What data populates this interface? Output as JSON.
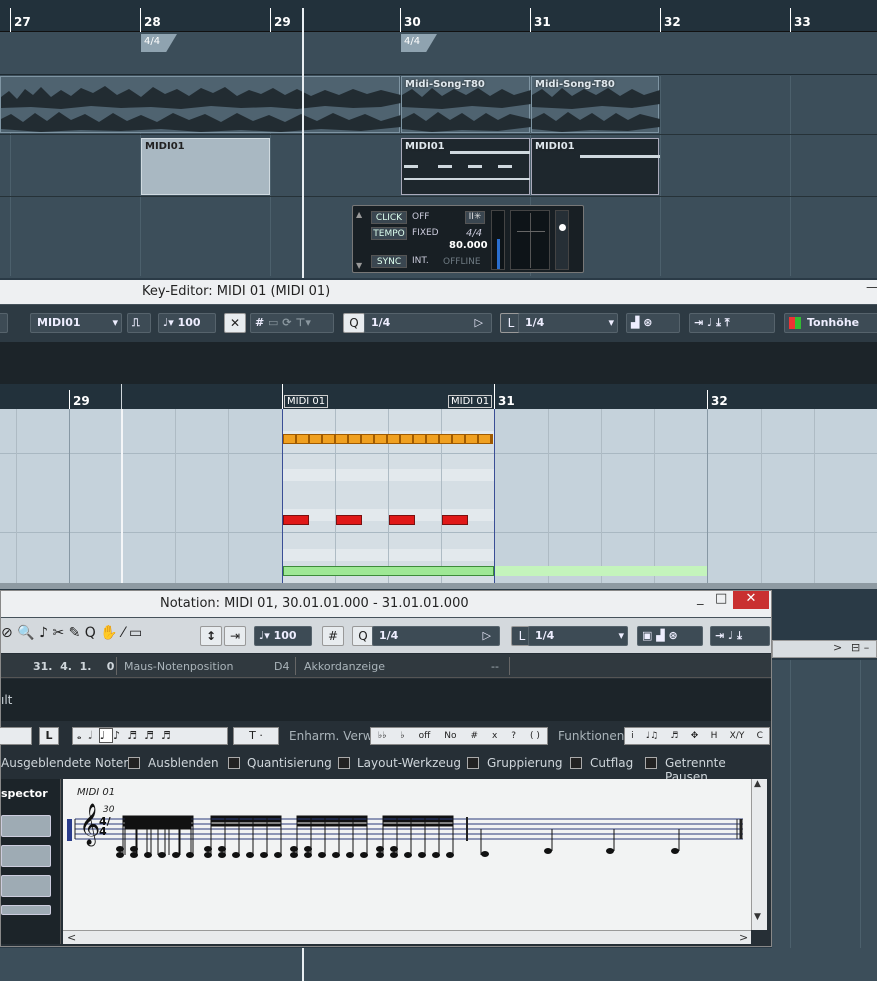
{
  "project": {
    "ruler_bars": [
      "27",
      "28",
      "29",
      "30",
      "31",
      "32",
      "33"
    ],
    "signatures": [
      "4/4",
      "4/4"
    ],
    "audio_events": [
      "Midi-Song-T80",
      "Midi-Song-T80"
    ],
    "midi_events": [
      "MIDI01",
      "MIDI01",
      "MIDI01"
    ]
  },
  "transport": {
    "click_label": "CLICK",
    "click_value": "OFF",
    "tempo_label": "TEMPO",
    "tempo_value": "FIXED",
    "sync_label": "SYNC",
    "sync_value": "INT.",
    "signature": "4/4",
    "tempo": "80.000",
    "status": "OFFLINE"
  },
  "key_editor": {
    "title": "Key-Editor: MIDI 01 (MIDI 01)",
    "part_select": "MIDI01",
    "velocity": "100",
    "quantize_label": "Q",
    "quantize_value": "1/4",
    "length_label": "L",
    "length_value": "1/4",
    "color_menu": "Tonhöhe",
    "ruler_bars": [
      "29",
      "31",
      "32"
    ],
    "part_labels": [
      "MIDI 01",
      "MIDI 01"
    ],
    "note_colors": {
      "orange": "#f0a020",
      "red": "#e01818",
      "green": "#9ee895"
    }
  },
  "notation": {
    "title": "Notation: MIDI 01, 30.01.01.000 - 31.01.01.000",
    "velocity": "100",
    "quantize_label": "Q",
    "quantize_value": "1/4",
    "length_label": "L",
    "length_value": "1/4",
    "position_value": "31.  4.  1.    0",
    "mouse_label": "Maus-Notenposition",
    "pitch_value": "D4",
    "chord_label": "Akkordanzeige",
    "chord_value": "--",
    "cut_text": "ılt",
    "enharm_label": "Enharm. Verw.",
    "functions_label": "Funktionen",
    "L_button": "L",
    "enh_buttons": [
      "♭♭",
      "♭",
      "off",
      "No",
      "#",
      "x",
      "?",
      "( )"
    ],
    "func_buttons": [
      "i",
      "♩♫",
      "♬",
      "✥",
      "H",
      "X/Y",
      "C"
    ],
    "checkboxes": [
      "Ausgeblendete Noten",
      "Ausblenden",
      "Quantisierung",
      "Layout-Werkzeug",
      "Gruppierung",
      "Cutflag",
      "Getrennte Pausen"
    ],
    "inspector_label": "spector",
    "staff_title": "MIDI 01",
    "staff_bar": "30",
    "clef": "𝄞",
    "timesig": "4/4"
  }
}
